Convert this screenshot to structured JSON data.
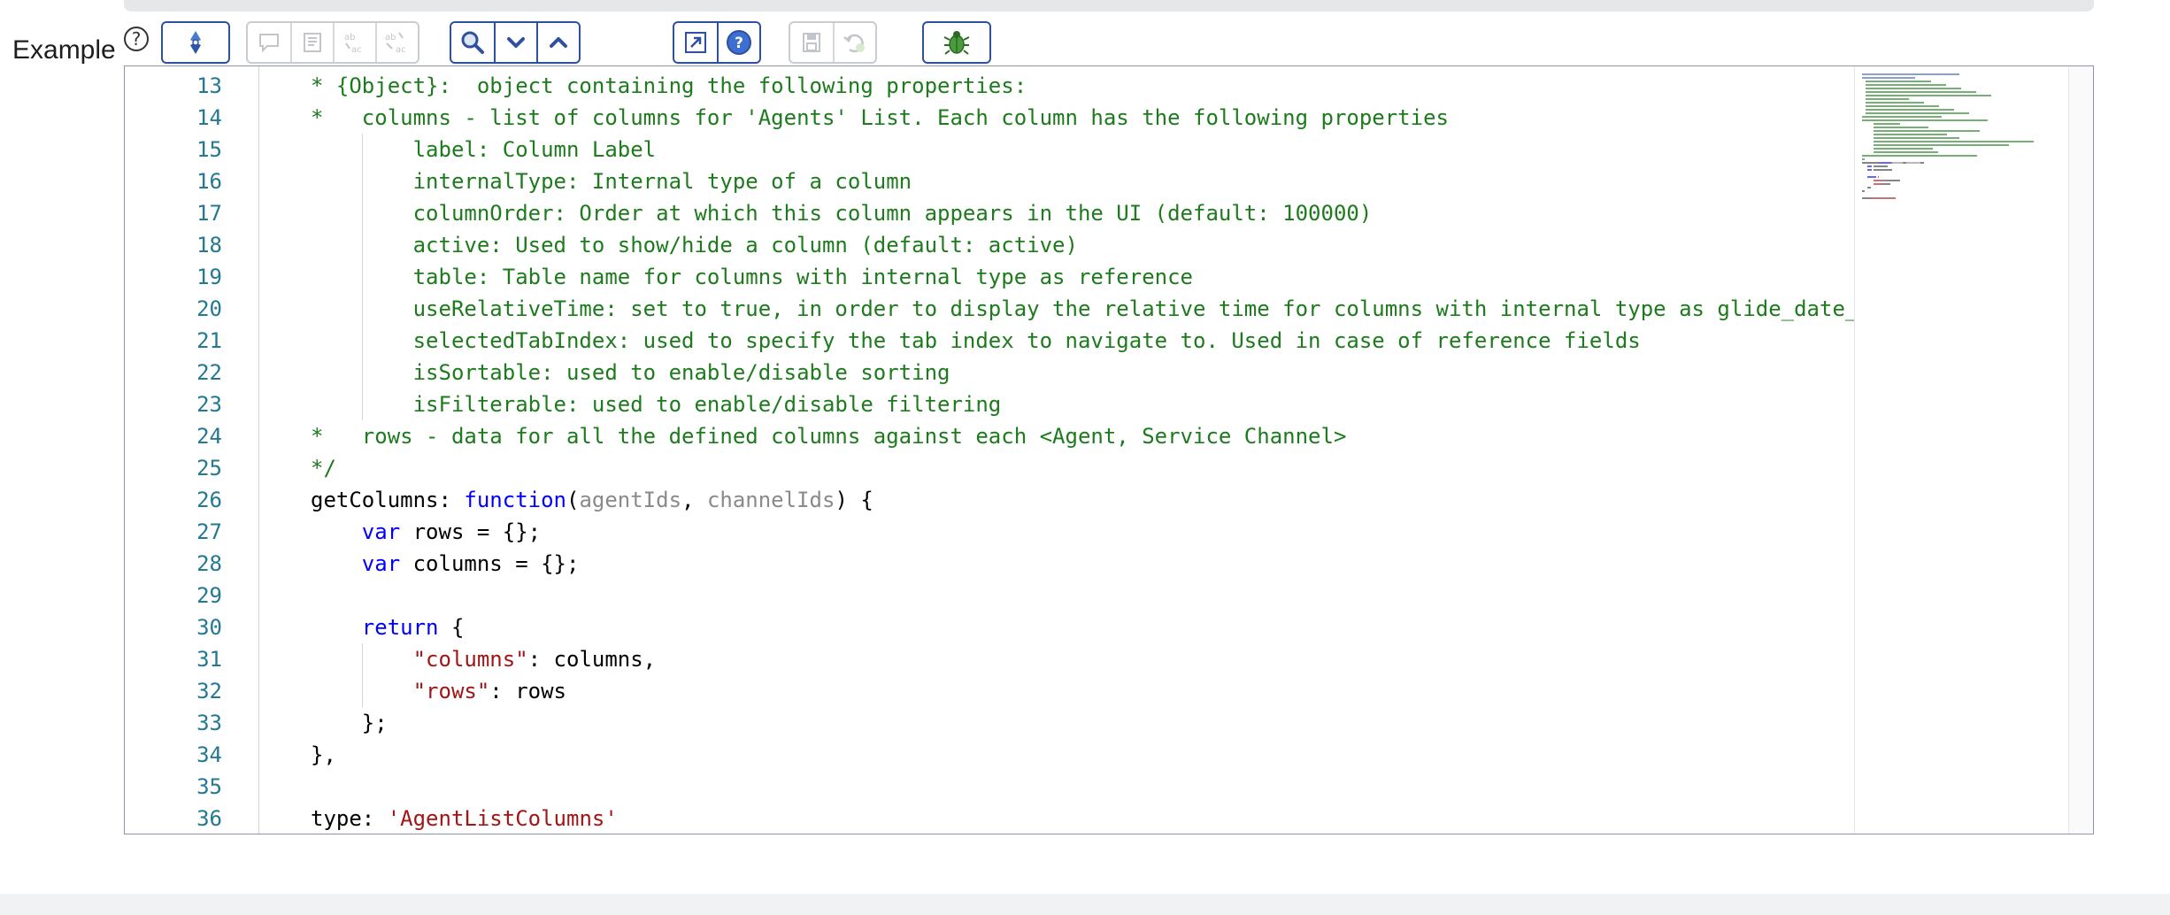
{
  "field": {
    "label": "Example",
    "help_icon": "help-circle-icon"
  },
  "toolbar": {
    "groups": [
      {
        "name": "script-tools",
        "enabled": true,
        "buttons": [
          {
            "icon": "script-debug-icon",
            "enabled": true
          }
        ]
      },
      {
        "name": "edit-tools",
        "enabled": false,
        "buttons": [
          {
            "icon": "comment-icon",
            "enabled": false
          },
          {
            "icon": "format-icon",
            "enabled": false
          },
          {
            "icon": "replace-icon",
            "enabled": false
          },
          {
            "icon": "replace-all-icon",
            "enabled": false
          }
        ]
      },
      {
        "name": "search-tools",
        "enabled": true,
        "buttons": [
          {
            "icon": "search-icon",
            "enabled": true
          },
          {
            "icon": "chevron-down-icon",
            "enabled": true
          },
          {
            "icon": "chevron-up-icon",
            "enabled": true
          }
        ]
      },
      {
        "name": "view-tools",
        "enabled": true,
        "buttons": [
          {
            "icon": "fullscreen-icon",
            "enabled": true
          },
          {
            "icon": "help-icon",
            "enabled": true
          }
        ]
      },
      {
        "name": "save-tools",
        "enabled": false,
        "buttons": [
          {
            "icon": "save-icon",
            "enabled": false
          },
          {
            "icon": "revert-icon",
            "enabled": false
          }
        ]
      },
      {
        "name": "debug-tools",
        "enabled": true,
        "buttons": [
          {
            "icon": "bug-icon",
            "enabled": true
          }
        ]
      }
    ]
  },
  "colors": {
    "comment": "#1d7b1d",
    "keyword": "#0000ff",
    "string": "#a31515",
    "param": "#8a8a8a",
    "line_number": "#237893",
    "toolbar_border": "#2f4fa0"
  },
  "editor": {
    "lines": [
      {
        "num": "13",
        "guides": [],
        "segments": [
          {
            "text": "* {Object}:  object containing the following properties:",
            "type": "comment"
          }
        ]
      },
      {
        "num": "14",
        "guides": [],
        "segments": [
          {
            "text": "*   columns - list of columns for 'Agents' List. Each column has the following properties",
            "type": "comment"
          }
        ]
      },
      {
        "num": "15",
        "guides": [
          1
        ],
        "segments": [
          {
            "text": "        label: Column Label",
            "type": "comment"
          }
        ]
      },
      {
        "num": "16",
        "guides": [
          1
        ],
        "segments": [
          {
            "text": "        internalType: Internal type of a column",
            "type": "comment"
          }
        ]
      },
      {
        "num": "17",
        "guides": [
          1
        ],
        "segments": [
          {
            "text": "        columnOrder: Order at which this column appears in the UI (default: 100000)",
            "type": "comment"
          }
        ]
      },
      {
        "num": "18",
        "guides": [
          1
        ],
        "segments": [
          {
            "text": "        active: Used to show/hide a column (default: active)",
            "type": "comment"
          }
        ]
      },
      {
        "num": "19",
        "guides": [
          1
        ],
        "segments": [
          {
            "text": "        table: Table name for columns with internal type as reference",
            "type": "comment"
          }
        ]
      },
      {
        "num": "20",
        "guides": [
          1
        ],
        "segments": [
          {
            "text": "        useRelativeTime: set to true, in order to display the relative time for columns with internal type as glide_date_",
            "type": "comment"
          }
        ]
      },
      {
        "num": "21",
        "guides": [
          1
        ],
        "segments": [
          {
            "text": "        selectedTabIndex: used to specify the tab index to navigate to. Used in case of reference fields",
            "type": "comment"
          }
        ]
      },
      {
        "num": "22",
        "guides": [
          1
        ],
        "segments": [
          {
            "text": "        isSortable: used to enable/disable sorting",
            "type": "comment"
          }
        ]
      },
      {
        "num": "23",
        "guides": [
          1
        ],
        "segments": [
          {
            "text": "        isFilterable: used to enable/disable filtering",
            "type": "comment"
          }
        ]
      },
      {
        "num": "24",
        "guides": [],
        "segments": [
          {
            "text": "*   rows - data for all the defined columns against each <Agent, Service Channel>",
            "type": "comment"
          }
        ]
      },
      {
        "num": "25",
        "guides": [],
        "segments": [
          {
            "text": "*/",
            "type": "comment"
          }
        ]
      },
      {
        "num": "26",
        "guides": [],
        "segments": [
          {
            "text": "getColumns: ",
            "type": "plain"
          },
          {
            "text": "function",
            "type": "keyword"
          },
          {
            "text": "(",
            "type": "plain"
          },
          {
            "text": "agentIds",
            "type": "param"
          },
          {
            "text": ", ",
            "type": "plain"
          },
          {
            "text": "channelIds",
            "type": "param"
          },
          {
            "text": ") {",
            "type": "plain"
          }
        ]
      },
      {
        "num": "27",
        "guides": [],
        "segments": [
          {
            "text": "    ",
            "type": "plain"
          },
          {
            "text": "var",
            "type": "keyword"
          },
          {
            "text": " rows = {};",
            "type": "plain"
          }
        ]
      },
      {
        "num": "28",
        "guides": [],
        "segments": [
          {
            "text": "    ",
            "type": "plain"
          },
          {
            "text": "var",
            "type": "keyword"
          },
          {
            "text": " columns = {};",
            "type": "plain"
          }
        ]
      },
      {
        "num": "29",
        "guides": [],
        "segments": [
          {
            "text": "",
            "type": "plain"
          }
        ]
      },
      {
        "num": "30",
        "guides": [],
        "segments": [
          {
            "text": "    ",
            "type": "plain"
          },
          {
            "text": "return",
            "type": "keyword"
          },
          {
            "text": " {",
            "type": "plain"
          }
        ]
      },
      {
        "num": "31",
        "guides": [
          1
        ],
        "segments": [
          {
            "text": "        ",
            "type": "plain"
          },
          {
            "text": "\"columns\"",
            "type": "string"
          },
          {
            "text": ": columns,",
            "type": "plain"
          }
        ]
      },
      {
        "num": "32",
        "guides": [
          1
        ],
        "segments": [
          {
            "text": "        ",
            "type": "plain"
          },
          {
            "text": "\"rows\"",
            "type": "string"
          },
          {
            "text": ": rows",
            "type": "plain"
          }
        ]
      },
      {
        "num": "33",
        "guides": [],
        "segments": [
          {
            "text": "    };",
            "type": "plain"
          }
        ]
      },
      {
        "num": "34",
        "guides": [],
        "segments": [
          {
            "text": "},",
            "type": "plain"
          }
        ]
      },
      {
        "num": "35",
        "guides": [],
        "segments": [
          {
            "text": "",
            "type": "plain"
          }
        ]
      },
      {
        "num": "36",
        "guides": [],
        "segments": [
          {
            "text": "type: ",
            "type": "plain"
          },
          {
            "text": "'AgentListColumns'",
            "type": "string"
          }
        ]
      }
    ]
  }
}
